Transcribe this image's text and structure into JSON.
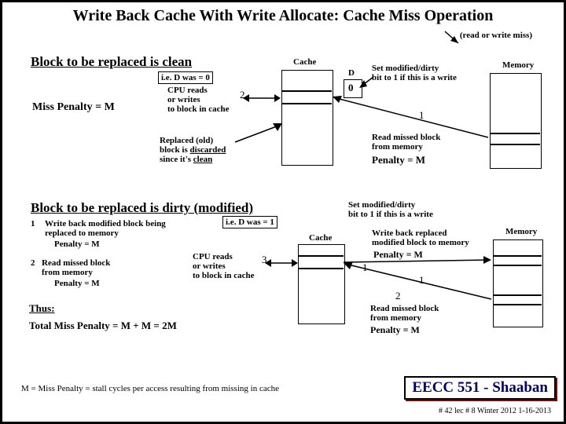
{
  "title": "Write Back Cache With Write Allocate:  Cache Miss Operation",
  "read_or_write": "(read or write miss)",
  "sec1": {
    "heading": "Block to be replaced is clean",
    "dwas": "i.e. D was = 0",
    "cpu": "CPU reads\nor writes\nto block in cache",
    "miss_penalty": "Miss Penalty  = M",
    "replaced": "Replaced (old)\nblock is discarded\nsince it's clean",
    "setmod": "Set modified/dirty\nbit to 1 if this is a write",
    "readblock": "Read missed block\nfrom memory",
    "penalty": "Penalty  = M",
    "cache_label": "Cache",
    "memory_label": "Memory",
    "D": "D",
    "zero": "0",
    "n1": "1",
    "n2": "2"
  },
  "sec2": {
    "heading": "Block to be replaced is dirty (modified)",
    "dwas": "i.e. D was = 1",
    "step1": "Write back modified block being\nreplaced to memory",
    "step1p": "Penalty  = M",
    "step2": "Read missed block\nfrom memory",
    "step2p": "Penalty  = M",
    "cpu": "CPU reads\nor writes\nto block in cache",
    "setmod": "Set modified/dirty\nbit to 1 if this is a write",
    "writeback": "Write back replaced\nmodified block to memory",
    "penalty1": "Penalty  = M",
    "readblock": "Read missed block\nfrom memory",
    "penalty2": "Penalty  = M",
    "thus": "Thus:",
    "total": "Total Miss Penalty  =  M + M = 2M",
    "cache_label": "Cache",
    "memory_label": "Memory",
    "n1": "1",
    "n2": "2",
    "n3": "3",
    "s1": "1",
    "s2": "2"
  },
  "footer1": "M  =  Miss Penalty = stall cycles per access resulting from missing in cache",
  "logo": "EECC 551 - Shaaban",
  "footer2": "# 42  lec # 8    Winter 2012  1-16-2013"
}
